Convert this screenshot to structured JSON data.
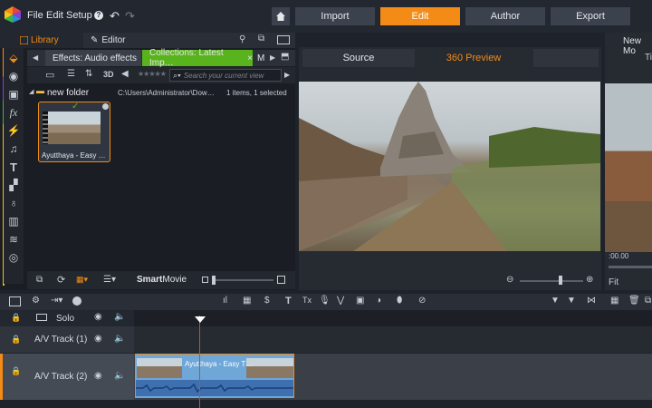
{
  "menu": {
    "file": "File",
    "edit": "Edit",
    "setup": "Setup"
  },
  "modes": {
    "import": "Import",
    "edit": "Edit",
    "author": "Author",
    "export": "Export"
  },
  "library": {
    "tab_library": "Library",
    "tab_editor": "Editor",
    "tab1": "Effects: Audio effects",
    "tab2": "Collections: Latest Imp…",
    "tab3": "M",
    "view_3d": "3D",
    "search_placeholder": "Search your current view",
    "stars": "★★★★★",
    "folder": "new folder",
    "path": "C:\\Users\\Administrator\\Dow…",
    "count": "1 items, 1 selected",
    "clip_name": "Ayutthaya - Easy …",
    "smartmovie_a": "Smart",
    "smartmovie_b": "Movie"
  },
  "player": {
    "source": "Source",
    "preview": "360 Preview"
  },
  "right": {
    "title": "New Mo",
    "sub": "Ti",
    "time": ":00.00",
    "fit": "Fit"
  },
  "timeline": {
    "solo": "Solo",
    "track1": "A/V Track (1)",
    "track2": "A/V Track (2)",
    "clip": "Ayutthaya - Easy T…"
  },
  "colors": {
    "accent": "#f38b16",
    "green": "#59b31c",
    "clip": "#6ea7d8"
  }
}
